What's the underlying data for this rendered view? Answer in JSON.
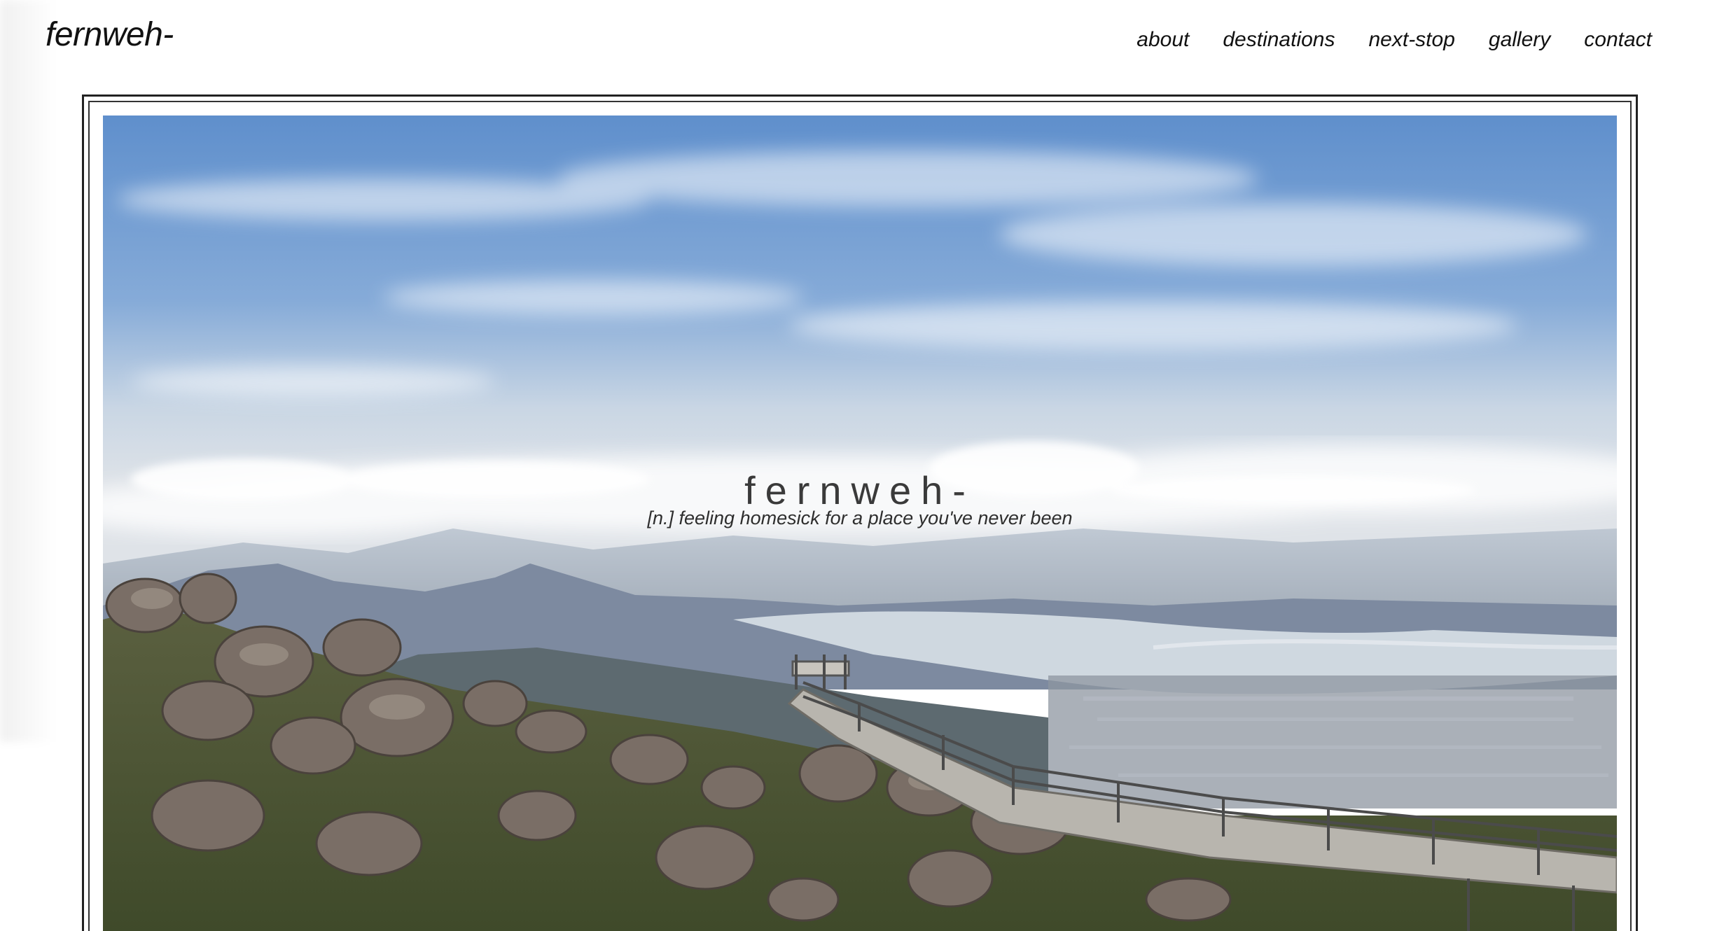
{
  "site": {
    "brand": "fernweh-"
  },
  "nav": {
    "items": [
      {
        "label": "about"
      },
      {
        "label": "destinations"
      },
      {
        "label": "next-stop"
      },
      {
        "label": "gallery"
      },
      {
        "label": "contact"
      }
    ]
  },
  "hero": {
    "title": "fernweh-",
    "subtitle": "[n.] feeling homesick for a place you've never been",
    "image_description_icon": "mountain-landscape-photo"
  },
  "colors": {
    "background": "#ffffff",
    "text": "#111111",
    "sky": "#7ea6d6",
    "cloud": "#f2f4f6",
    "water": "#cfd8e0",
    "rock": "#7a6e66",
    "vegetation": "#4f5a35",
    "boardwalk": "#b8b5ae"
  }
}
